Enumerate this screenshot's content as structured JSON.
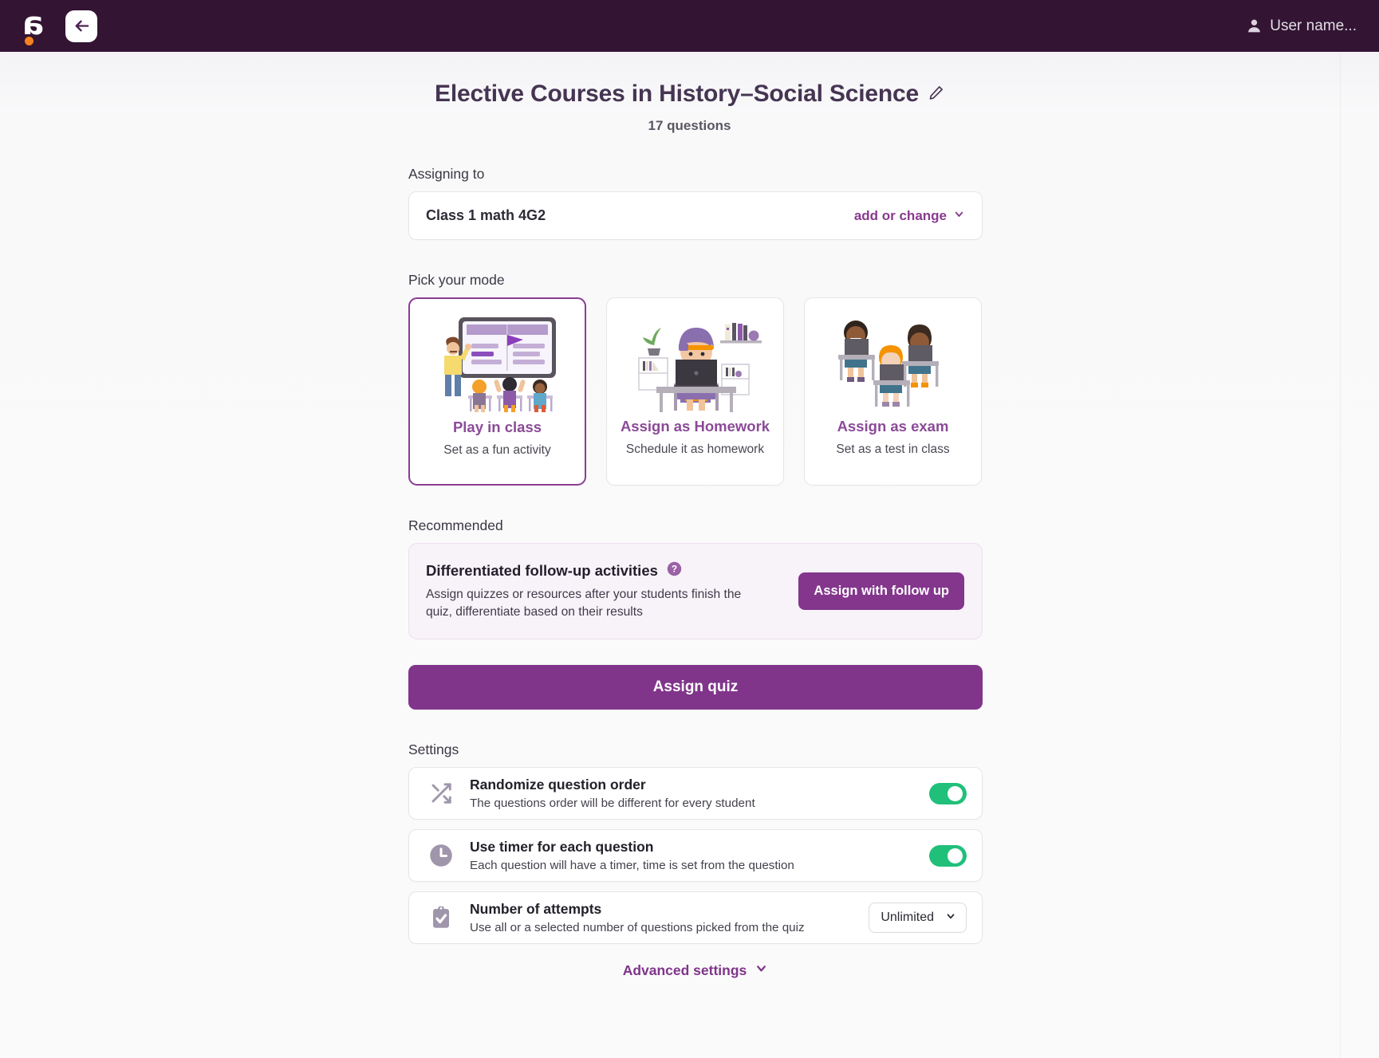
{
  "topbar": {
    "logo_name": "logo-a-mark",
    "back_label": "Back",
    "user_name": "User name..."
  },
  "header": {
    "title": "Elective Courses in History–Social Science",
    "edit_icon": "pencil-icon",
    "question_count": "17 questions"
  },
  "assigning": {
    "label": "Assigning to",
    "class_name": "Class 1 math 4G2",
    "add_or_change": "add or change"
  },
  "mode": {
    "label": "Pick your mode",
    "cards": [
      {
        "title": "Play in class",
        "subtitle": "Set as a fun activity",
        "selected": true,
        "art": "teacher-at-whiteboard-with-students"
      },
      {
        "title": "Assign as Homework",
        "subtitle": "Schedule it as homework",
        "selected": false,
        "art": "student-at-desk-with-laptop"
      },
      {
        "title": "Assign as exam",
        "subtitle": "Set as a test in class",
        "selected": false,
        "art": "three-students-at-desks-with-laptops"
      }
    ]
  },
  "recommended": {
    "label": "Recommended",
    "title": "Differentiated follow-up activities",
    "help_icon": "question-mark-circle-icon",
    "description": "Assign quizzes or resources after your students finish the quiz, differentiate based on their results",
    "button": "Assign with follow up"
  },
  "primary_action": {
    "assign_quiz": "Assign quiz"
  },
  "settings": {
    "label": "Settings",
    "rows": [
      {
        "icon": "shuffle-icon",
        "title": "Randomize question order",
        "description": "The questions order will be different for every student",
        "control": "toggle",
        "value": "on"
      },
      {
        "icon": "clock-icon",
        "title": "Use timer for each question",
        "description": "Each question will have a timer, time is set from the question",
        "control": "toggle",
        "value": "on"
      },
      {
        "icon": "clipboard-check-icon",
        "title": "Number of attempts",
        "description": "Use all or a selected number of questions picked from the quiz",
        "control": "select",
        "value": "Unlimited"
      }
    ],
    "advanced": "Advanced settings"
  },
  "colors": {
    "brand_dark": "#331433",
    "accent_purple": "#83368c",
    "toggle_on": "#20c07a",
    "orange_dot": "#f58220"
  }
}
